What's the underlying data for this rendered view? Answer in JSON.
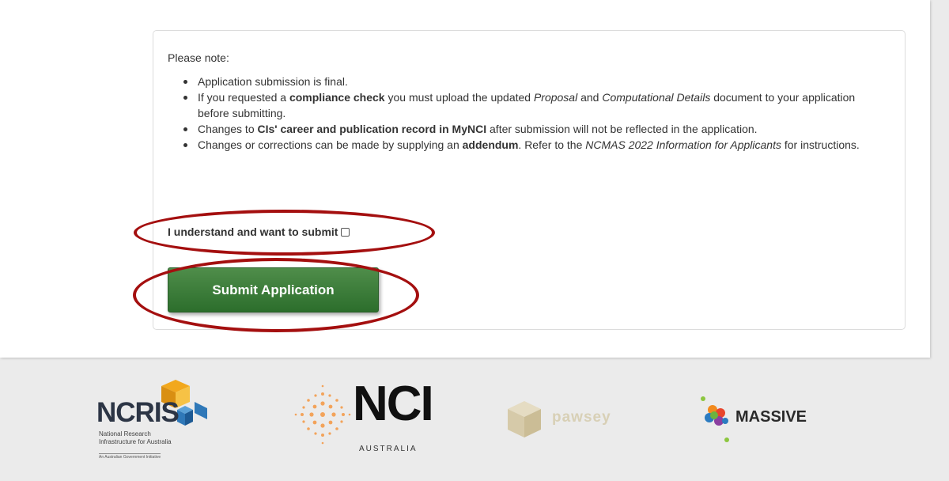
{
  "notice": {
    "title": "Please note:",
    "items": [
      {
        "segments": [
          {
            "t": "Application submission is final.",
            "s": "n"
          }
        ]
      },
      {
        "segments": [
          {
            "t": "If you requested a ",
            "s": "n"
          },
          {
            "t": "compliance check",
            "s": "b"
          },
          {
            "t": " you must upload the updated ",
            "s": "n"
          },
          {
            "t": "Proposal",
            "s": "i"
          },
          {
            "t": " and ",
            "s": "n"
          },
          {
            "t": "Computational Details",
            "s": "i"
          },
          {
            "t": " document to your application before submitting.",
            "s": "n"
          }
        ]
      },
      {
        "segments": [
          {
            "t": "Changes to ",
            "s": "n"
          },
          {
            "t": "CIs' career and publication record in MyNCI",
            "s": "b"
          },
          {
            "t": " after submission will not be reflected in the application.",
            "s": "n"
          }
        ]
      },
      {
        "segments": [
          {
            "t": "Changes or corrections can be made by supplying an ",
            "s": "n"
          },
          {
            "t": "addendum",
            "s": "b"
          },
          {
            "t": ". Refer to the ",
            "s": "n"
          },
          {
            "t": "NCMAS 2022 Information for Applicants",
            "s": "i"
          },
          {
            "t": " for instructions.",
            "s": "n"
          }
        ]
      }
    ]
  },
  "confirm": {
    "label": "I understand and want to submit",
    "checked": false
  },
  "submit": {
    "label": "Submit Application"
  },
  "annotation_color": "#a40f0f",
  "button_color": "#3a7a38",
  "footer": {
    "logos": [
      {
        "name": "NCRIS",
        "subtitle": "National Research Infrastructure for Australia",
        "tagline": "An Australian Government Initiative"
      },
      {
        "name": "NCI",
        "subtitle": "AUSTRALIA"
      },
      {
        "name": "pawsey"
      },
      {
        "name": "MASSIVE"
      }
    ]
  }
}
